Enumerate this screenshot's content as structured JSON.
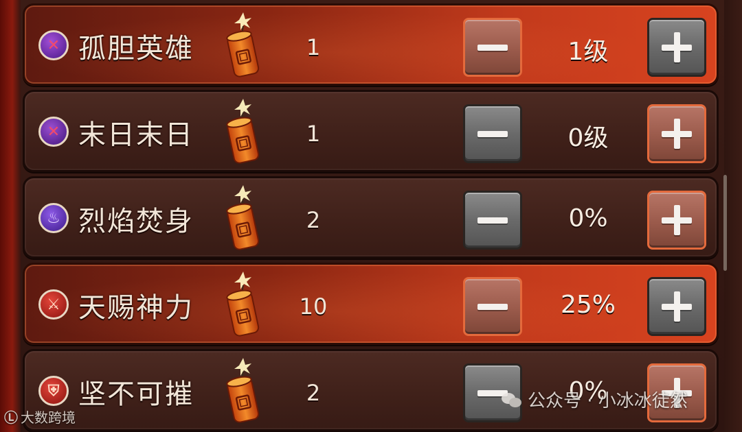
{
  "skills": [
    {
      "name": "孤胆英雄",
      "cost": "1",
      "level": "1级",
      "icon": "lonely-hero-icon",
      "state": "active",
      "minus_style": "red",
      "plus_style": "gray"
    },
    {
      "name": "末日末日",
      "cost": "1",
      "level": "0级",
      "icon": "doom-icon",
      "state": "normal",
      "minus_style": "gray",
      "plus_style": "red"
    },
    {
      "name": "烈焰焚身",
      "cost": "2",
      "level": "0%",
      "icon": "flame-icon",
      "state": "normal",
      "minus_style": "gray",
      "plus_style": "red"
    },
    {
      "name": "天赐神力",
      "cost": "10",
      "level": "25%",
      "icon": "divine-power-icon",
      "state": "active",
      "minus_style": "red",
      "plus_style": "gray"
    },
    {
      "name": "坚不可摧",
      "cost": "2",
      "level": "0%",
      "icon": "shield-icon",
      "state": "normal",
      "minus_style": "gray",
      "plus_style": "red"
    }
  ],
  "cost_icon": "firecracker-icon",
  "watermarks": {
    "left": "大数跨境",
    "left_mark": "Ⓛ",
    "right": "公众号 · 小冰冰徒然"
  },
  "colors": {
    "active_row": "#c23a1c",
    "normal_row": "#3f2019",
    "button_gray": "#6a6a6a",
    "button_red": "#9a5a4b"
  }
}
